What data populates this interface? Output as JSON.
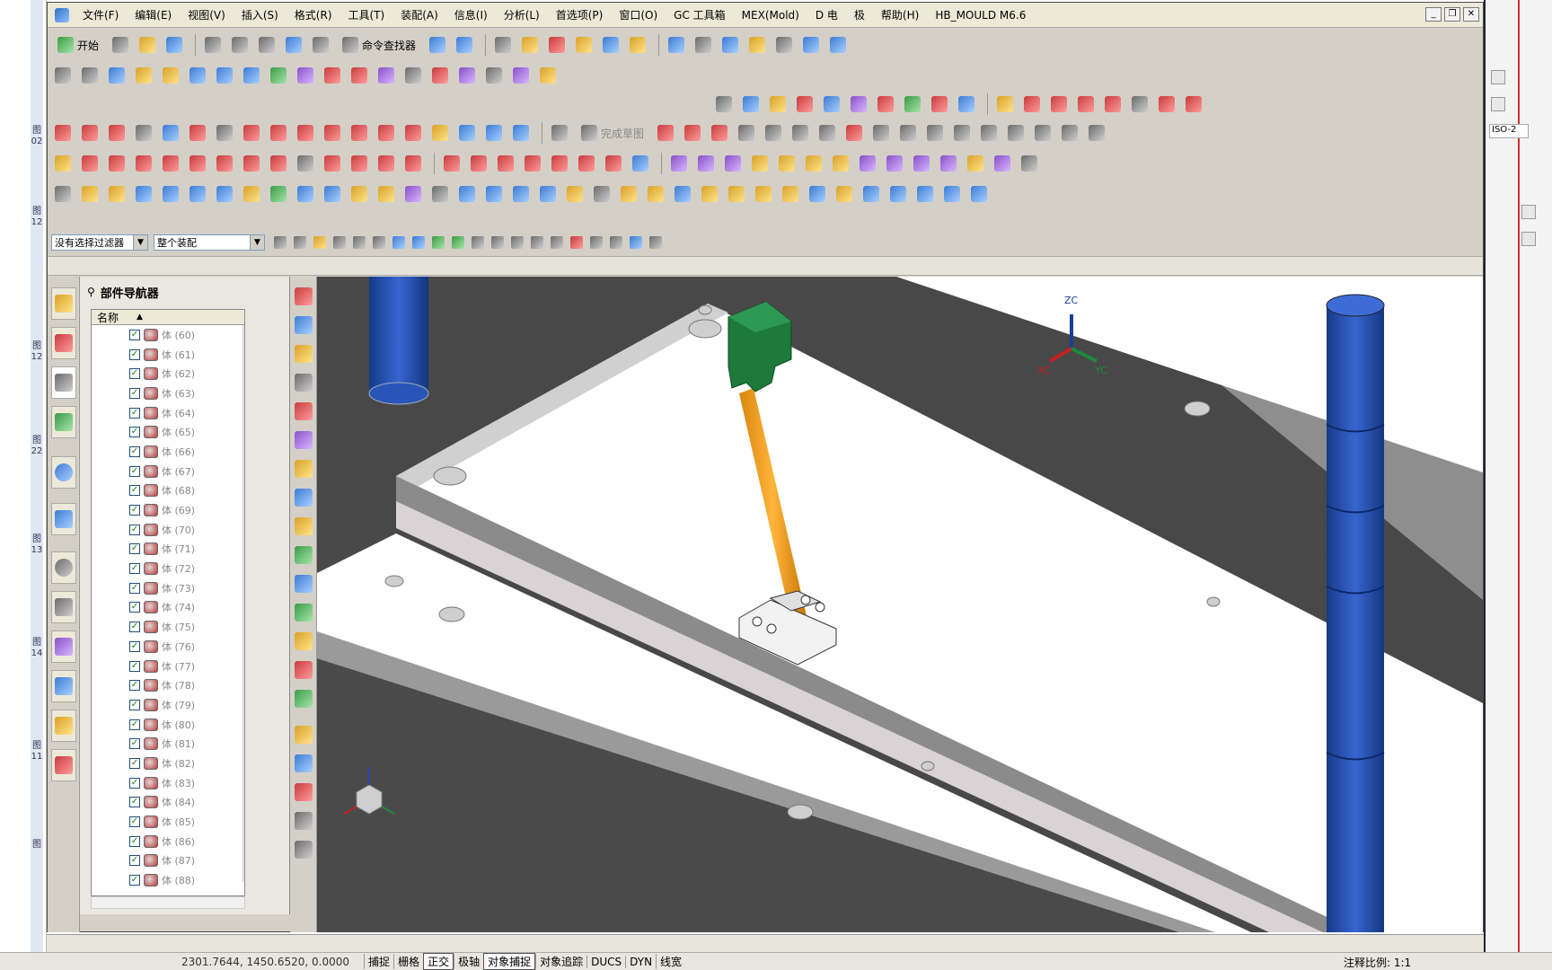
{
  "window": {
    "title_menu": [
      "文件(F)",
      "编辑(E)",
      "视图(V)",
      "插入(S)",
      "格式(R)",
      "工具(T)",
      "装配(A)",
      "信息(I)",
      "分析(L)",
      "首选项(P)",
      "窗口(O)",
      "GC 工具箱",
      "MEX(Mold)",
      "D 电",
      "极",
      "帮助(H)",
      "HB_MOULD M6.6"
    ],
    "controls": [
      "_",
      "❐",
      "✕"
    ]
  },
  "toolbar": {
    "start_label": "开始",
    "command_finder_label": "命令查找器",
    "finish_sketch_label": "完成草图"
  },
  "filters": {
    "selection_filter": "没有选择过滤器",
    "assembly_scope": "整个装配"
  },
  "part_navigator": {
    "title": "部件导航器",
    "column_name": "名称",
    "rows": [
      {
        "label": "体 (60)",
        "checked": true
      },
      {
        "label": "体 (61)",
        "checked": true
      },
      {
        "label": "体 (62)",
        "checked": true
      },
      {
        "label": "体 (63)",
        "checked": true
      },
      {
        "label": "体 (64)",
        "checked": true
      },
      {
        "label": "体 (65)",
        "checked": true
      },
      {
        "label": "体 (66)",
        "checked": true
      },
      {
        "label": "体 (67)",
        "checked": true
      },
      {
        "label": "体 (68)",
        "checked": true
      },
      {
        "label": "体 (69)",
        "checked": true
      },
      {
        "label": "体 (70)",
        "checked": true
      },
      {
        "label": "体 (71)",
        "checked": true
      },
      {
        "label": "体 (72)",
        "checked": true
      },
      {
        "label": "体 (73)",
        "checked": true
      },
      {
        "label": "体 (74)",
        "checked": true
      },
      {
        "label": "体 (75)",
        "checked": true
      },
      {
        "label": "体 (76)",
        "checked": true
      },
      {
        "label": "体 (77)",
        "checked": true
      },
      {
        "label": "体 (78)",
        "checked": true
      },
      {
        "label": "体 (79)",
        "checked": true
      },
      {
        "label": "体 (80)",
        "checked": true
      },
      {
        "label": "体 (81)",
        "checked": true
      },
      {
        "label": "体 (82)",
        "checked": true
      },
      {
        "label": "体 (83)",
        "checked": true
      },
      {
        "label": "体 (84)",
        "checked": true
      },
      {
        "label": "体 (85)",
        "checked": true
      },
      {
        "label": "体 (86)",
        "checked": true
      },
      {
        "label": "体 (87)",
        "checked": true
      },
      {
        "label": "体 (88)",
        "checked": true
      }
    ]
  },
  "viewport": {
    "wcs_labels": {
      "z": "ZC",
      "x": "XC",
      "y": "YC"
    },
    "colors": {
      "background": "#484848",
      "plate": "#ffffff",
      "plate_edge": "#9a9a9a",
      "pillar": "#1f4aa8",
      "green_part": "#1c7a3a",
      "rod": "#f0a020"
    }
  },
  "status_bar": {
    "coords": "2301.7644, 1450.6520, 0.0000",
    "toggles": [
      "捕捉",
      "栅格",
      "正交",
      "极轴",
      "对象捕捉",
      "对象追踪",
      "DUCS",
      "DYN",
      "线宽"
    ],
    "active_toggles": [
      "正交",
      "对象捕捉"
    ],
    "annotation_scale": "注释比例: 1:1"
  },
  "right_panel": {
    "view_label": "ISO-2"
  },
  "desktop_tags": [
    "图02",
    "图12",
    "图12",
    "图22",
    "图13",
    "图14",
    "图11",
    "图"
  ]
}
